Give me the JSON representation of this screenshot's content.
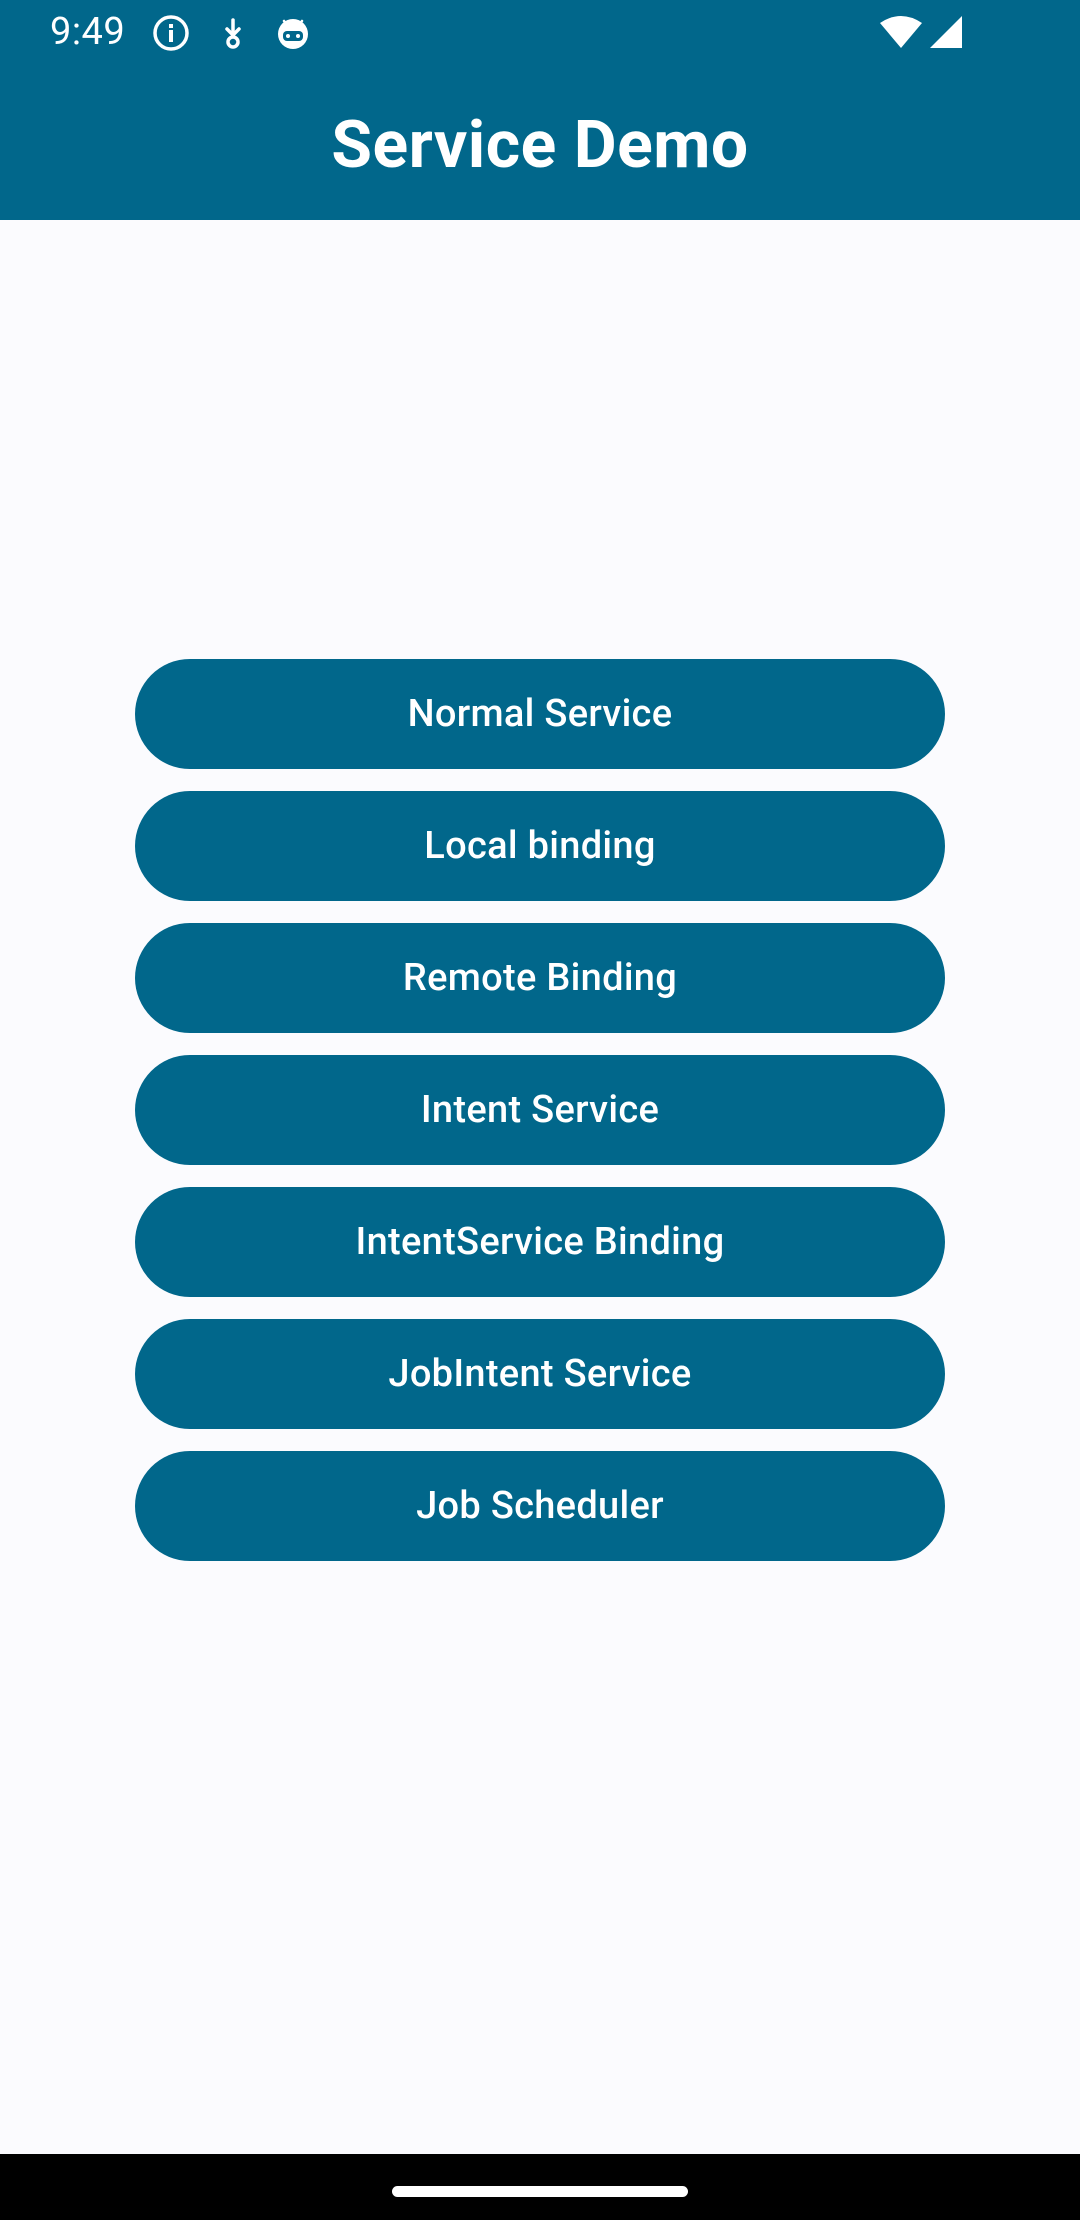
{
  "status_bar": {
    "time": "9:49",
    "left_icons": [
      "info-icon",
      "download-icon",
      "android-icon"
    ],
    "right_icons": [
      "wifi-icon",
      "cell-signal-icon"
    ]
  },
  "app_bar": {
    "title": "Service Demo"
  },
  "buttons": [
    "Normal Service",
    "Local binding",
    "Remote Binding",
    "Intent Service",
    "IntentService Binding",
    "JobIntent Service",
    "Job Scheduler"
  ],
  "colors": {
    "primary": "#01678b",
    "background": "#fbfbfe",
    "on_primary": "#ffffff"
  }
}
